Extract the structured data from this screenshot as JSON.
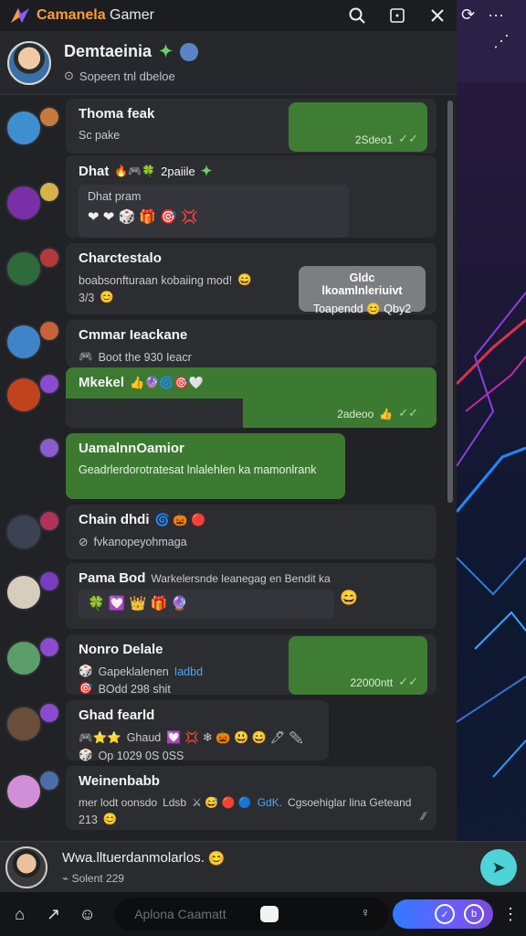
{
  "app": {
    "title_part1": "Camanela",
    "title_part2": " Gamer"
  },
  "profile": {
    "name": "Demtaeinia",
    "status": "Sopeen tnl dbeloe"
  },
  "chats": [
    {
      "title": "Thoma feak",
      "sub": "Sc pake",
      "bubble_time": "2Sdeo1",
      "kind": "green-right"
    },
    {
      "title": "Dhat",
      "inner": "Dhat pram",
      "kind": "emoji-inner",
      "title_suffix": "2paiile"
    },
    {
      "title": "Charctestalo",
      "sub": "boabsonfturaan kobaiing mod!",
      "sub2": "3/3",
      "gray_line1": "Gldc lkoamlnleriuivt",
      "gray_line2": "Toapendd",
      "gray_line3": "Qby2",
      "kind": "gray-right"
    },
    {
      "title": "Cmmar Ieackane",
      "sub": "Boot the 930 Ieacr",
      "kind": "plain"
    },
    {
      "title": "Mkekel",
      "bubble_time": "2adeoo",
      "kind": "green-full"
    },
    {
      "title": "UamalnnOamior",
      "sub": "Geadrlerdorotratesat lnlalehlen ka mamonlrank",
      "kind": "green-card"
    },
    {
      "title": "Chain dhdi",
      "sub": "fvkanopeyohmaga",
      "kind": "plain"
    },
    {
      "title": "Pama Bod",
      "title_extra": "Warkelersnde leanegag en Bendit ka",
      "kind": "emoji-row"
    },
    {
      "title": "Nonro Delale",
      "sub": "Gapeklalenen",
      "sub_link": "Iadbd",
      "sub2": "BOdd 298 shit",
      "bubble_time": "22000ntt",
      "kind": "green-right"
    },
    {
      "title": "Ghad fearld",
      "sub": "Ghaud",
      "sub2": "Op 1029 0S 0SS",
      "kind": "emoji-row2"
    },
    {
      "title": "Weinenbabb",
      "sub": "mer lodt oonsdo",
      "sub_mid": "Ldsb",
      "sub_link": "GdK.",
      "sub_end": "Cgsoehiglar lina Geteand",
      "sub2": "213",
      "kind": "plain-long"
    }
  ],
  "composer": {
    "title": "Wwa.lltuerdanmolarlos.",
    "sub": "Solent 229"
  },
  "bottom": {
    "search_placeholder": "Aplona Caamatt"
  },
  "colors": {
    "accent_green": "#3f7d34",
    "accent_teal": "#4ed3d7",
    "title_orange": "#ff9c3a"
  }
}
